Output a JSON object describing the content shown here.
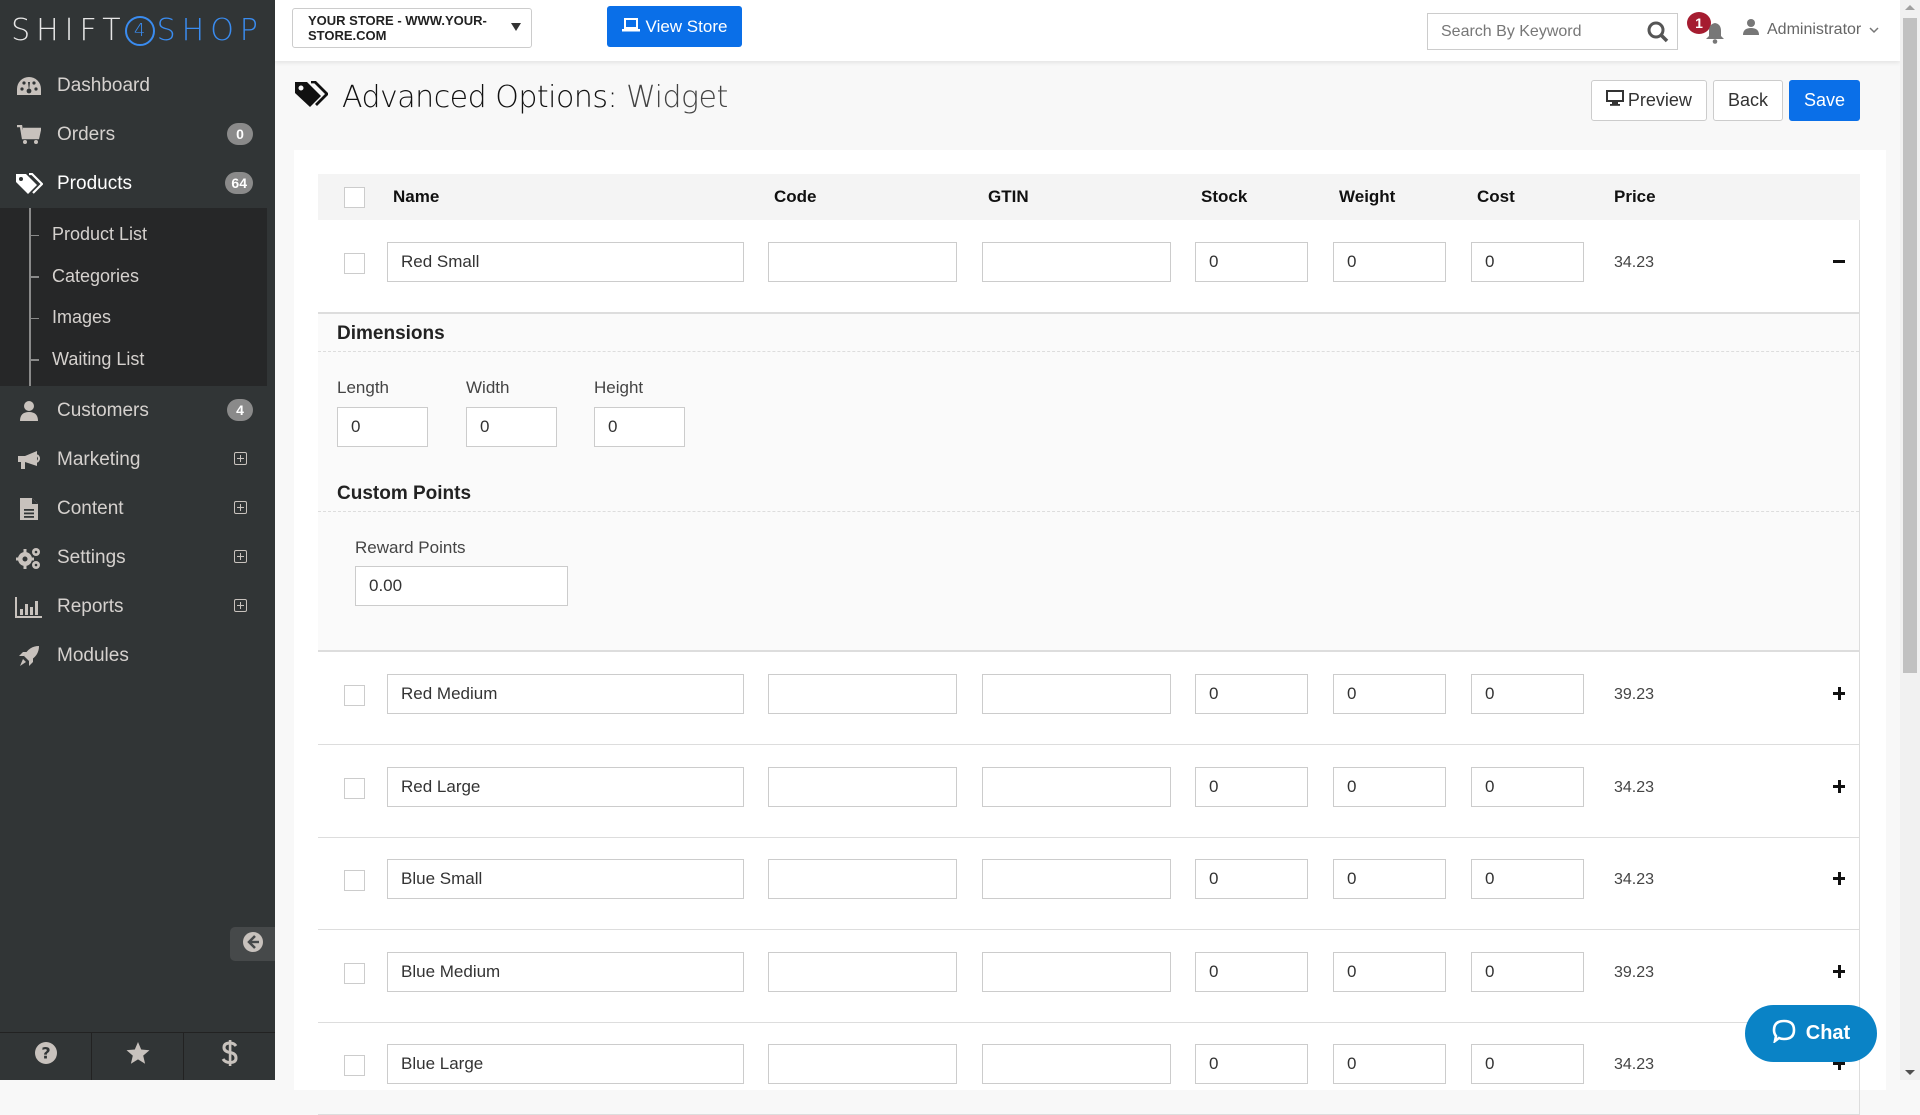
{
  "brand": {
    "left": "SHIFT",
    "middle": "4",
    "right": "SHOP"
  },
  "sidebar": {
    "items": [
      {
        "label": "Dashboard",
        "icon": "dashboard-icon"
      },
      {
        "label": "Orders",
        "icon": "cart-icon",
        "badge": "0"
      },
      {
        "label": "Products",
        "icon": "tags-icon",
        "badge": "64",
        "active": true
      },
      {
        "label": "Customers",
        "icon": "user-icon",
        "badge": "4"
      },
      {
        "label": "Marketing",
        "icon": "megaphone-icon",
        "expandable": true
      },
      {
        "label": "Content",
        "icon": "file-icon",
        "expandable": true
      },
      {
        "label": "Settings",
        "icon": "gears-icon",
        "expandable": true
      },
      {
        "label": "Reports",
        "icon": "bar-chart-icon",
        "expandable": true
      },
      {
        "label": "Modules",
        "icon": "rocket-icon"
      }
    ],
    "subitems": [
      "Product List",
      "Categories",
      "Images",
      "Waiting List"
    ],
    "footer": [
      "help-icon",
      "star-icon",
      "dollar-icon"
    ]
  },
  "topbar": {
    "store": "YOUR STORE - WWW.YOUR-STORE.COM",
    "view_store": "View Store",
    "search_placeholder": "Search By Keyword",
    "notifications": "1",
    "user": "Administrator"
  },
  "page": {
    "title": "Advanced Options:",
    "subtitle": "Widget",
    "actions": {
      "preview": "Preview",
      "back": "Back",
      "save": "Save"
    }
  },
  "table": {
    "columns": [
      "Name",
      "Code",
      "GTIN",
      "Stock",
      "Weight",
      "Cost",
      "Price"
    ],
    "rows": [
      {
        "name": "Red Small",
        "code": "",
        "gtin": "",
        "stock": "0",
        "weight": "0",
        "cost": "0",
        "price": "34.23",
        "expanded": true
      },
      {
        "name": "Red Medium",
        "code": "",
        "gtin": "",
        "stock": "0",
        "weight": "0",
        "cost": "0",
        "price": "39.23"
      },
      {
        "name": "Red Large",
        "code": "",
        "gtin": "",
        "stock": "0",
        "weight": "0",
        "cost": "0",
        "price": "34.23"
      },
      {
        "name": "Blue Small",
        "code": "",
        "gtin": "",
        "stock": "0",
        "weight": "0",
        "cost": "0",
        "price": "34.23"
      },
      {
        "name": "Blue Medium",
        "code": "",
        "gtin": "",
        "stock": "0",
        "weight": "0",
        "cost": "0",
        "price": "39.23"
      },
      {
        "name": "Blue Large",
        "code": "",
        "gtin": "",
        "stock": "0",
        "weight": "0",
        "cost": "0",
        "price": "34.23"
      }
    ]
  },
  "details": {
    "dimensions_title": "Dimensions",
    "length_label": "Length",
    "length": "0",
    "width_label": "Width",
    "width": "0",
    "height_label": "Height",
    "height": "0",
    "points_title": "Custom Points",
    "reward_label": "Reward Points",
    "reward": "0.00"
  },
  "chat": {
    "label": "Chat"
  },
  "colors": {
    "primary": "#0a6fe8",
    "sidebar": "#313536",
    "chat": "#0a83c6",
    "notification": "#a51c30"
  }
}
